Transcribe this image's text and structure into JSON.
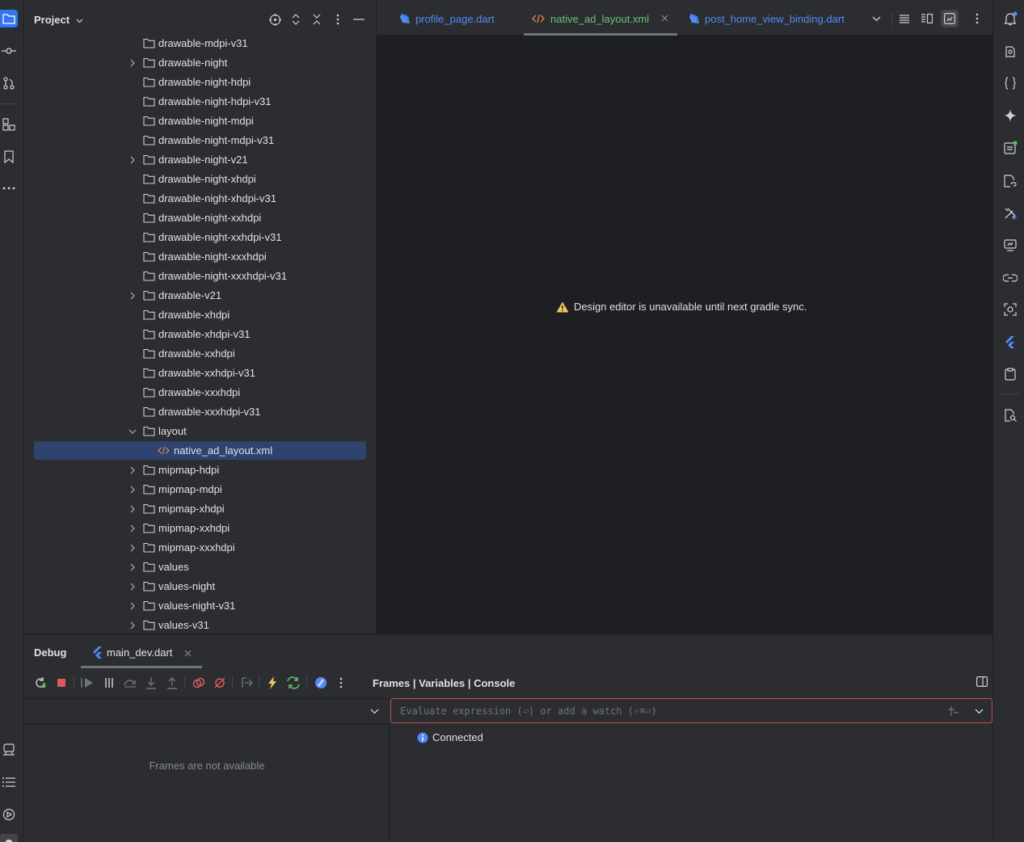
{
  "project_panel": {
    "title": "Project",
    "tree": [
      {
        "label": "drawable-mdpi-v31",
        "expandable": false,
        "icon": "folder-icon"
      },
      {
        "label": "drawable-night",
        "expandable": true,
        "icon": "folder-icon"
      },
      {
        "label": "drawable-night-hdpi",
        "expandable": false,
        "icon": "folder-icon"
      },
      {
        "label": "drawable-night-hdpi-v31",
        "expandable": false,
        "icon": "folder-icon"
      },
      {
        "label": "drawable-night-mdpi",
        "expandable": false,
        "icon": "folder-icon"
      },
      {
        "label": "drawable-night-mdpi-v31",
        "expandable": false,
        "icon": "folder-icon"
      },
      {
        "label": "drawable-night-v21",
        "expandable": true,
        "icon": "folder-icon"
      },
      {
        "label": "drawable-night-xhdpi",
        "expandable": false,
        "icon": "folder-icon"
      },
      {
        "label": "drawable-night-xhdpi-v31",
        "expandable": false,
        "icon": "folder-icon"
      },
      {
        "label": "drawable-night-xxhdpi",
        "expandable": false,
        "icon": "folder-icon"
      },
      {
        "label": "drawable-night-xxhdpi-v31",
        "expandable": false,
        "icon": "folder-icon"
      },
      {
        "label": "drawable-night-xxxhdpi",
        "expandable": false,
        "icon": "folder-icon"
      },
      {
        "label": "drawable-night-xxxhdpi-v31",
        "expandable": false,
        "icon": "folder-icon"
      },
      {
        "label": "drawable-v21",
        "expandable": true,
        "icon": "folder-icon"
      },
      {
        "label": "drawable-xhdpi",
        "expandable": false,
        "icon": "folder-icon"
      },
      {
        "label": "drawable-xhdpi-v31",
        "expandable": false,
        "icon": "folder-icon"
      },
      {
        "label": "drawable-xxhdpi",
        "expandable": false,
        "icon": "folder-icon"
      },
      {
        "label": "drawable-xxhdpi-v31",
        "expandable": false,
        "icon": "folder-icon"
      },
      {
        "label": "drawable-xxxhdpi",
        "expandable": false,
        "icon": "folder-icon"
      },
      {
        "label": "drawable-xxxhdpi-v31",
        "expandable": false,
        "icon": "folder-icon"
      },
      {
        "label": "layout",
        "expandable": true,
        "expanded": true,
        "icon": "folder-icon"
      },
      {
        "label": "native_ad_layout.xml",
        "expandable": false,
        "icon": "xml-file-icon",
        "selected": true,
        "depth": 1
      },
      {
        "label": "mipmap-hdpi",
        "expandable": true,
        "icon": "folder-icon"
      },
      {
        "label": "mipmap-mdpi",
        "expandable": true,
        "icon": "folder-icon"
      },
      {
        "label": "mipmap-xhdpi",
        "expandable": true,
        "icon": "folder-icon"
      },
      {
        "label": "mipmap-xxhdpi",
        "expandable": true,
        "icon": "folder-icon"
      },
      {
        "label": "mipmap-xxxhdpi",
        "expandable": true,
        "icon": "folder-icon"
      },
      {
        "label": "values",
        "expandable": true,
        "icon": "folder-icon"
      },
      {
        "label": "values-night",
        "expandable": true,
        "icon": "folder-icon"
      },
      {
        "label": "values-night-v31",
        "expandable": true,
        "icon": "folder-icon"
      },
      {
        "label": "values-v31",
        "expandable": true,
        "icon": "folder-icon"
      }
    ]
  },
  "editor": {
    "tabs": [
      {
        "label": "profile_page.dart",
        "icon": "dart-icon",
        "active": false,
        "closable": false
      },
      {
        "label": "native_ad_layout.xml",
        "icon": "xml-file-icon",
        "active": true,
        "closable": true
      },
      {
        "label": "post_home_view_binding.dart",
        "icon": "dart-icon",
        "active": false,
        "closable": false
      }
    ],
    "message": "Design editor is unavailable until next gradle sync."
  },
  "debug": {
    "title": "Debug",
    "session_tab": "main_dev.dart",
    "frames_tabs": "Frames | Variables | Console",
    "frames_empty": "Frames are not available",
    "eval_placeholder": "Evaluate expression (⏎) or add a watch (⇧⌘⏎)",
    "console_status": "Connected"
  },
  "colors": {
    "accent": "#548af7",
    "active_tab_text": "#6dbf78",
    "xml_icon": "#e08855",
    "selection": "#2e436e",
    "warning": "#f2c55c",
    "error_border": "#c94f4f",
    "info": "#548af7"
  }
}
